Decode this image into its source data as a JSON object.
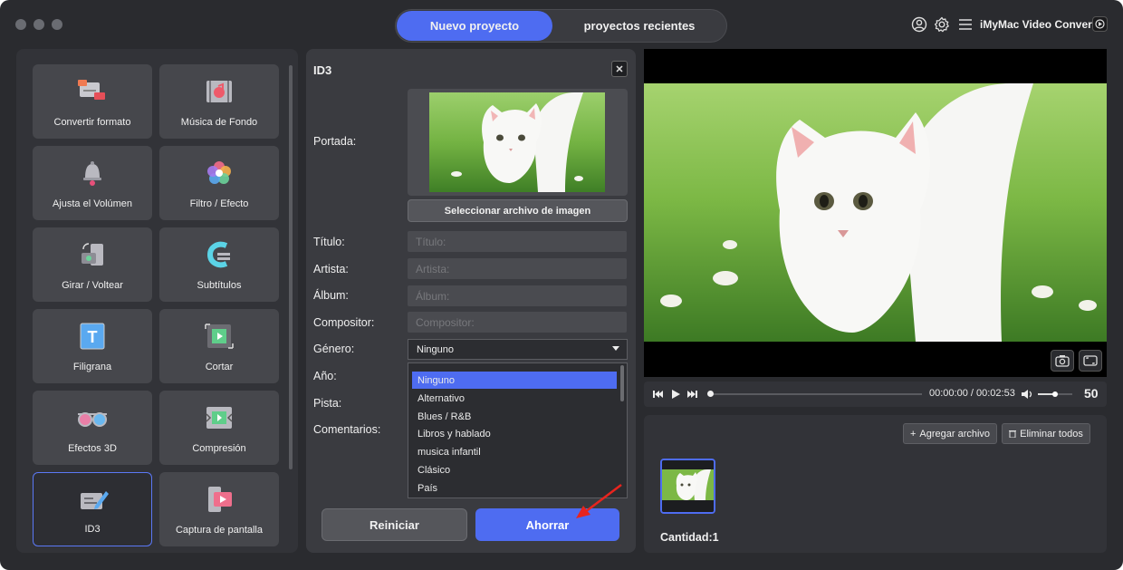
{
  "header": {
    "tabs": [
      {
        "label": "Nuevo proyecto",
        "active": true
      },
      {
        "label": "proyectos recientes",
        "active": false
      }
    ],
    "app_name": "iMyMac Video Converter",
    "icons": [
      "user-icon",
      "gear-icon",
      "menu-icon",
      "app-logo-icon"
    ]
  },
  "tools": [
    {
      "label": "Convertir formato",
      "icon": "convert-format-icon"
    },
    {
      "label": "Música de Fondo",
      "icon": "background-music-icon"
    },
    {
      "label": "Ajusta el Volúmen",
      "icon": "volume-bell-icon"
    },
    {
      "label": "Filtro / Efecto",
      "icon": "filter-effect-icon"
    },
    {
      "label": "Girar / Voltear",
      "icon": "rotate-flip-icon"
    },
    {
      "label": "Subtítulos",
      "icon": "subtitles-icon"
    },
    {
      "label": "Filigrana",
      "icon": "watermark-icon"
    },
    {
      "label": "Cortar",
      "icon": "crop-icon"
    },
    {
      "label": "Efectos 3D",
      "icon": "3d-glasses-icon"
    },
    {
      "label": "Compresión",
      "icon": "compression-icon"
    },
    {
      "label": "ID3",
      "icon": "id3-tag-icon",
      "selected": true
    },
    {
      "label": "Captura de pantalla",
      "icon": "screen-capture-icon"
    }
  ],
  "id3": {
    "title": "ID3",
    "close_icon": "close-icon",
    "labels": {
      "cover": "Portada:",
      "title": "Título:",
      "artist": "Artista:",
      "album": "Álbum:",
      "composer": "Compositor:",
      "genre": "Género:",
      "year": "Año:",
      "track": "Pista:",
      "comments": "Comentarios:"
    },
    "placeholders": {
      "title": "Título:",
      "artist": "Artista:",
      "album": "Álbum:",
      "composer": "Compositor:"
    },
    "select_image_button": "Seleccionar archivo de imagen",
    "genre_value": "Ninguno",
    "genre_options": [
      "Ninguno",
      "Alternativo",
      "Blues / R&B",
      "Libros y hablado",
      "musica infantil",
      "Clásico",
      "País"
    ],
    "reset_button": "Reiniciar",
    "save_button": "Ahorrar"
  },
  "player": {
    "time": "00:00:00 / 00:02:53",
    "volume": "50",
    "volume_level": 0.5,
    "progress": 0
  },
  "files": {
    "add_button": "Agregar archivo",
    "remove_all_button": "Eliminar todos",
    "count_label": "Cantidad:1"
  },
  "colors": {
    "accent": "#4e6cf1",
    "background": "#2a2b2f",
    "panel": "#323338"
  }
}
